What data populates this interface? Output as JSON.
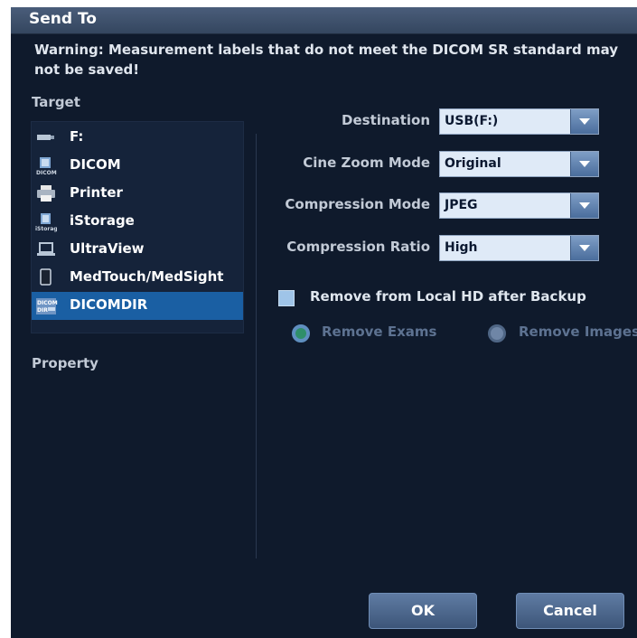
{
  "dialog": {
    "title": "Send To",
    "warning": "Warning: Measurement labels that do not meet the DICOM SR standard may not be saved!"
  },
  "target": {
    "label": "Target",
    "items": [
      {
        "label": "F:",
        "icon": "usb-drive-icon"
      },
      {
        "label": "DICOM",
        "icon": "dicom-icon"
      },
      {
        "label": "Printer",
        "icon": "printer-icon"
      },
      {
        "label": "iStorage",
        "icon": "istorage-icon"
      },
      {
        "label": "UltraView",
        "icon": "laptop-icon"
      },
      {
        "label": "MedTouch/MedSight",
        "icon": "tablet-icon"
      },
      {
        "label": "DICOMDIR",
        "icon": "dicomdir-icon",
        "selected": true
      }
    ]
  },
  "property": {
    "label": "Property"
  },
  "settings": {
    "destination": {
      "label": "Destination",
      "value": "USB(F:)"
    },
    "cine_zoom_mode": {
      "label": "Cine Zoom Mode",
      "value": "Original"
    },
    "compression_mode": {
      "label": "Compression Mode",
      "value": "JPEG"
    },
    "compression_ratio": {
      "label": "Compression Ratio",
      "value": "High"
    }
  },
  "backup": {
    "remove_local_label": "Remove from Local HD after Backup",
    "remove_local_checked": false,
    "remove_exams_label": "Remove Exams",
    "remove_images_label": "Remove Images",
    "selected_option": "Remove Exams"
  },
  "buttons": {
    "ok": "OK",
    "cancel": "Cancel"
  },
  "colors": {
    "background": "#0f1a2c",
    "selected": "#1a5fa3",
    "disabled_text": "#5d7291"
  }
}
